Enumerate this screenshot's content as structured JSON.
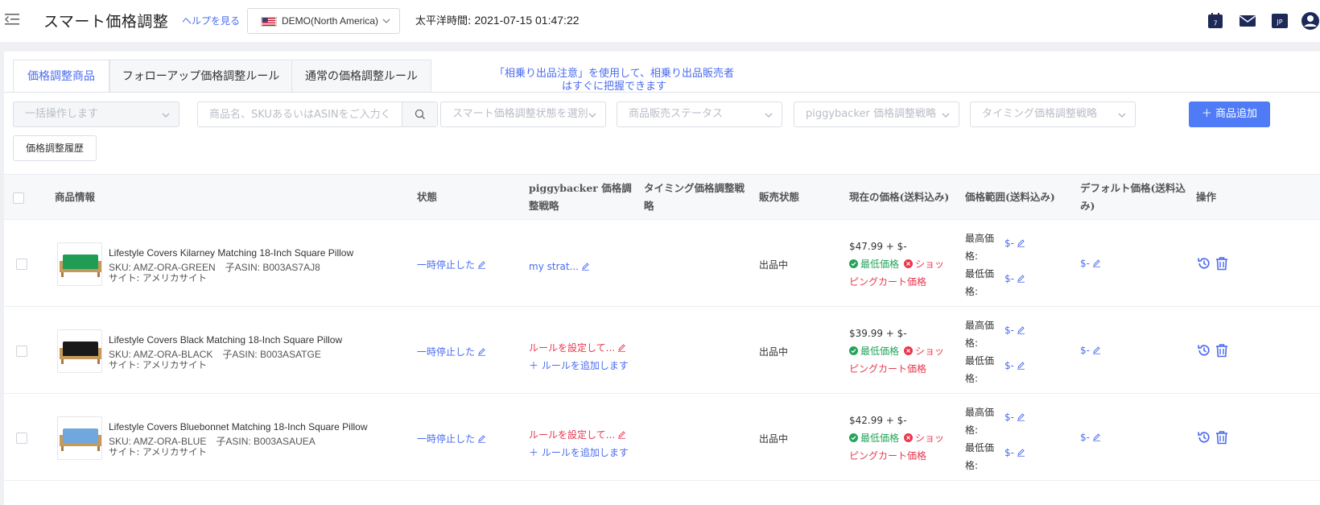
{
  "header": {
    "title": "スマート価格調整",
    "help_link": "ヘルプを見る",
    "region": "DEMO(North America)",
    "clock_label": "太平洋時間: ",
    "clock_value": "2021-07-15 01:47:22",
    "calendar_day": "7",
    "lang": "JP"
  },
  "tabs": [
    {
      "label": "価格調整商品",
      "active": true
    },
    {
      "label": "フォローアップ価格調整ルール",
      "active": false
    },
    {
      "label": "通常の価格調整ルール",
      "active": false
    }
  ],
  "notice": "「相乗り出品注意」を使用して、相乗り出品販売者はすぐに把握できます",
  "filters": {
    "bulk_action": "一括操作します",
    "search_placeholder": "商品名、SKUあるいはASINをご入力く",
    "smart_status": "スマート価格調整状態を選別",
    "sales_status": "商品販売ステータス",
    "piggyback_strategy": "piggybacker 価格調整戦略",
    "timing_strategy": "タイミング価格調整戦略",
    "add_button": "＋ 商品追加",
    "history_button": "価格調整履歴"
  },
  "table": {
    "headers": {
      "product": "商品情報",
      "status": "状態",
      "piggyback": "piggybacker 価格調整戦略",
      "timing": "タイミング価格調整戦略",
      "sales": "販売状態",
      "price": "現在の価格(送料込み)",
      "range": "価格範囲(送料込み)",
      "default": "デフォルト価格(送料込み)",
      "ops": "操作"
    },
    "rows": [
      {
        "name": "Lifestyle Covers Kilarney Matching 18-Inch Square Pillow",
        "sku": "SKU: AMZ-ORA-GREEN　子ASIN: B003AS7AJ8",
        "site": "サイト: アメリカサイト",
        "status": "一時停止した",
        "strategy": "my strat...",
        "strategy_type": "link",
        "add_rule": "",
        "sales": "出品中",
        "price": "$47.99 + $-",
        "lowest": "最低価格",
        "cart": "ショッピングカート価格",
        "max_label": "最高価格:",
        "max_val": "$-",
        "min_label": "最低価格:",
        "min_val": "$-",
        "default": "$-",
        "color": "#1f9d55"
      },
      {
        "name": "Lifestyle Covers Black Matching 18-Inch Square Pillow",
        "sku": "SKU: AMZ-ORA-BLACK　子ASIN: B003ASATGE",
        "site": "サイト: アメリカサイト",
        "status": "一時停止した",
        "strategy": "ルールを設定して...",
        "strategy_type": "warn",
        "add_rule": "＋ ルールを追加します",
        "sales": "出品中",
        "price": "$39.99 + $-",
        "lowest": "最低価格",
        "cart": "ショッピングカート価格",
        "max_label": "最高価格:",
        "max_val": "$-",
        "min_label": "最低価格:",
        "min_val": "$-",
        "default": "$-",
        "color": "#1a1a1a"
      },
      {
        "name": "Lifestyle Covers Bluebonnet Matching 18-Inch Square Pillow",
        "sku": "SKU: AMZ-ORA-BLUE　子ASIN: B003ASAUEA",
        "site": "サイト: アメリカサイト",
        "status": "一時停止した",
        "strategy": "ルールを設定して...",
        "strategy_type": "warn",
        "add_rule": "＋ ルールを追加します",
        "sales": "出品中",
        "price": "$42.99 + $-",
        "lowest": "最低価格",
        "cart": "ショッピングカート価格",
        "max_label": "最高価格:",
        "max_val": "$-",
        "min_label": "最低価格:",
        "min_val": "$-",
        "default": "$-",
        "color": "#6fa8dc"
      }
    ]
  }
}
